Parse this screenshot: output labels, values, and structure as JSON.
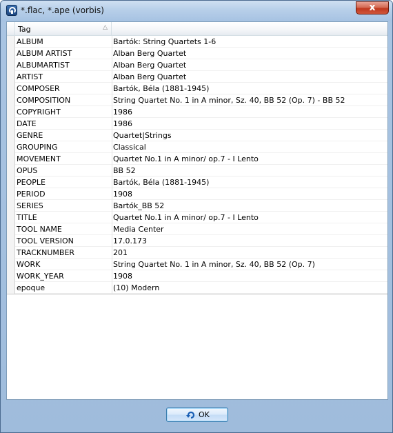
{
  "window": {
    "title": "*.flac, *.ape (vorbis)",
    "close_label": "x"
  },
  "grid": {
    "columns": {
      "tag": "Tag",
      "value": ""
    },
    "rows": [
      {
        "tag": "ALBUM",
        "value": "Bartók: String Quartets 1-6"
      },
      {
        "tag": "ALBUM ARTIST",
        "value": "Alban Berg Quartet"
      },
      {
        "tag": "ALBUMARTIST",
        "value": "Alban Berg Quartet"
      },
      {
        "tag": "ARTIST",
        "value": "Alban Berg Quartet"
      },
      {
        "tag": "COMPOSER",
        "value": "Bartók, Béla (1881-1945)"
      },
      {
        "tag": "COMPOSITION",
        "value": "String Quartet No. 1 in A minor, Sz. 40, BB 52 (Op. 7) - BB 52"
      },
      {
        "tag": "COPYRIGHT",
        "value": "1986"
      },
      {
        "tag": "DATE",
        "value": "1986"
      },
      {
        "tag": "GENRE",
        "value": "Quartet|Strings"
      },
      {
        "tag": "GROUPING",
        "value": "Classical"
      },
      {
        "tag": "MOVEMENT",
        "value": "Quartet No.1 in A minor/ op.7 - I Lento"
      },
      {
        "tag": "OPUS",
        "value": "BB 52"
      },
      {
        "tag": "PEOPLE",
        "value": "Bartók, Béla (1881-1945)"
      },
      {
        "tag": "PERIOD",
        "value": "1908"
      },
      {
        "tag": "SERIES",
        "value": "Bartók_BB 52"
      },
      {
        "tag": "TITLE",
        "value": "Quartet No.1 in A minor/ op.7 - I Lento"
      },
      {
        "tag": "TOOL NAME",
        "value": "Media Center"
      },
      {
        "tag": "TOOL VERSION",
        "value": "17.0.173"
      },
      {
        "tag": "TRACKNUMBER",
        "value": "201"
      },
      {
        "tag": "WORK",
        "value": "String Quartet No. 1 in A minor, Sz. 40, BB 52 (Op. 7)"
      },
      {
        "tag": "WORK_YEAR",
        "value": "1908"
      },
      {
        "tag": "epoque",
        "value": "(10) Modern"
      }
    ]
  },
  "footer": {
    "ok_label": "OK"
  },
  "icons": {
    "app": "app-icon",
    "sort": "sort-ascending-icon",
    "ok": "refresh-arrow-icon"
  }
}
